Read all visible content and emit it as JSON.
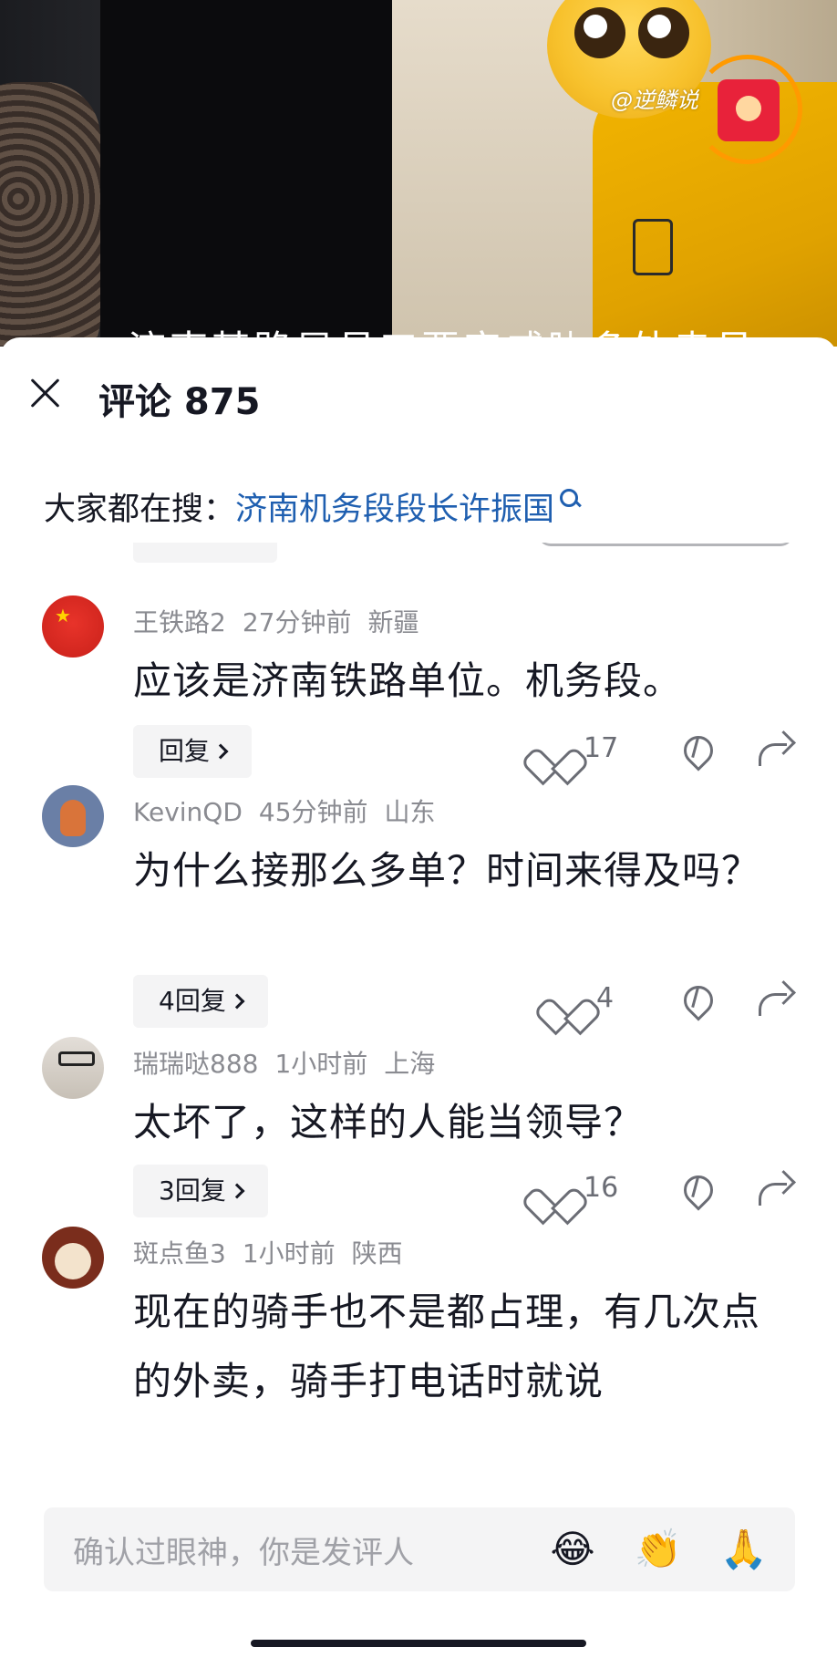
{
  "video": {
    "watermark": "@逆鳞说",
    "subtitle": "济南某路局员工要审威胁多外卖员"
  },
  "header": {
    "title": "评论 875"
  },
  "search": {
    "prefix": "大家都在搜：",
    "query": "济南机务段段长许振国"
  },
  "comments": [
    {
      "username": "王铁路2",
      "time": "27分钟前",
      "location": "新疆",
      "text": "应该是济南铁路单位。机务段。",
      "reply_label": "回复",
      "likes": "17"
    },
    {
      "username": "KevinQD",
      "time": "45分钟前",
      "location": "山东",
      "text": "为什么接那么多单？时间来得及吗？",
      "reply_label": "4回复",
      "likes": "4"
    },
    {
      "username": "瑞瑞哒888",
      "time": "1小时前",
      "location": "上海",
      "text": "太坏了，这样的人能当领导？",
      "reply_label": "3回复",
      "likes": "16"
    },
    {
      "username": "斑点鱼3",
      "time": "1小时前",
      "location": "陕西",
      "text": "现在的骑手也不是都占理，有几次点的外卖，骑手打电话时就说"
    }
  ],
  "input": {
    "placeholder": "确认过眼神，你是发评人",
    "emojis": [
      "😂",
      "👏",
      "🙏"
    ]
  }
}
